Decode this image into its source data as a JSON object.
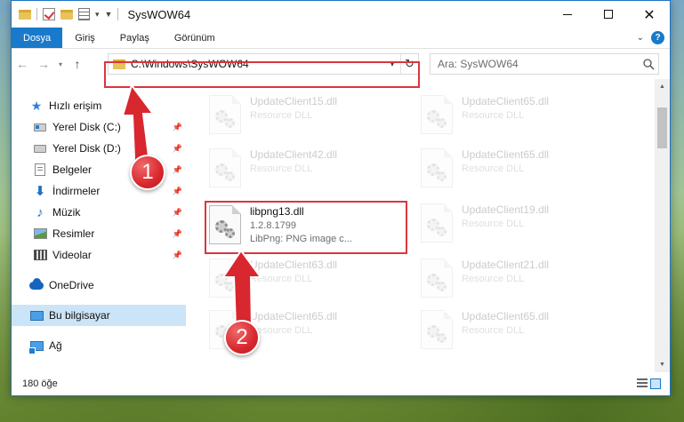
{
  "window": {
    "title": "SysWOW64",
    "controls": {
      "minimize": "–",
      "maximize": "□",
      "close": "✕"
    }
  },
  "ribbon": {
    "tabs": [
      {
        "label": "Dosya"
      },
      {
        "label": "Giriş"
      },
      {
        "label": "Paylaş"
      },
      {
        "label": "Görünüm"
      }
    ],
    "help": "?"
  },
  "navigation": {
    "address": "C:\\Windows\\SysWOW64",
    "search_placeholder": "Ara: SysWOW64"
  },
  "sidebar": {
    "quick_access": "Hızlı erişim",
    "items": [
      {
        "label": "Yerel Disk (C:)",
        "icon": "drive-icon"
      },
      {
        "label": "Yerel Disk (D:)",
        "icon": "drive-icon"
      },
      {
        "label": "Belgeler",
        "icon": "documents-icon"
      },
      {
        "label": "İndirmeler",
        "icon": "downloads-icon"
      },
      {
        "label": "Müzik",
        "icon": "music-icon"
      },
      {
        "label": "Resimler",
        "icon": "pictures-icon"
      },
      {
        "label": "Videolar",
        "icon": "videos-icon"
      }
    ],
    "onedrive": "OneDrive",
    "this_pc": "Bu bilgisayar",
    "network": "Ağ"
  },
  "files": {
    "left": [
      {
        "name": "UpdateClient15.dll",
        "sub": "Resource DLL"
      },
      {
        "name": "UpdateClient42.dll",
        "sub": "Resource DLL"
      },
      {
        "name": "libpng13.dll",
        "sub": "1.2.8.1799",
        "sub2": "LibPng: PNG image c..."
      },
      {
        "name": "UpdateClient63.dll",
        "sub": "Resource DLL"
      },
      {
        "name": "UpdateClient65.dll",
        "sub": "Resource DLL"
      }
    ],
    "right": [
      {
        "name": "UpdateClient65.dll",
        "sub": "Resource DLL"
      },
      {
        "name": "UpdateClient65.dll",
        "sub": "Resource DLL"
      },
      {
        "name": "UpdateClient19.dll",
        "sub": "Resource DLL"
      },
      {
        "name": "UpdateClient21.dll",
        "sub": "Resource DLL"
      },
      {
        "name": "UpdateClient65.dll",
        "sub": "Resource DLL"
      }
    ]
  },
  "status": {
    "item_count": "180 öğe"
  },
  "callouts": {
    "step1": "1",
    "step2": "2"
  },
  "colors": {
    "accent": "#1979ca",
    "highlight": "#d9363e",
    "selected": "#cce4f7"
  }
}
